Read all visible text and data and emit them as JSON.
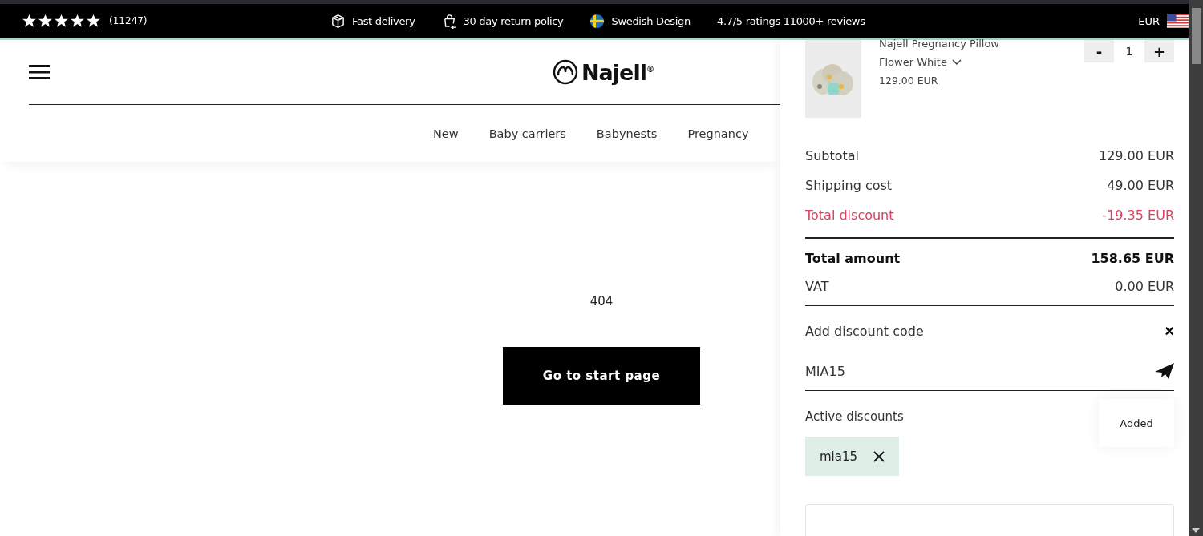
{
  "top_bar": {
    "rating": {
      "stars": 5,
      "count": "(11247)"
    },
    "usps": [
      {
        "kind": "box",
        "label": "Fast delivery"
      },
      {
        "kind": "return",
        "label": "30 day return policy"
      },
      {
        "kind": "flag",
        "label": "Swedish Design"
      },
      {
        "kind": "none",
        "label": "4.7/5 ratings 11000+ reviews"
      }
    ],
    "currency": "EUR"
  },
  "header": {
    "logo": "Najell",
    "logo_mark": "®"
  },
  "nav": [
    "New",
    "Baby carriers",
    "Babynests",
    "Pregnancy"
  ],
  "main": {
    "code": "404",
    "button": "Go to start page"
  },
  "cart": {
    "item": {
      "name": "Najell Pregnancy Pillow",
      "variant": "Flower White",
      "price": "129.00 EUR",
      "minus": "-",
      "quantity": "1",
      "plus": "+"
    },
    "summary": [
      {
        "kind": "normal",
        "label": "Subtotal",
        "value": "129.00 EUR"
      },
      {
        "kind": "normal",
        "label": "Shipping cost",
        "value": "49.00 EUR"
      },
      {
        "kind": "discount",
        "label": "Total discount",
        "value": "-19.35 EUR"
      },
      {
        "kind": "total",
        "label": "Total amount",
        "value": "158.65 EUR"
      },
      {
        "kind": "normal",
        "label": "VAT",
        "value": "0.00 EUR"
      }
    ],
    "discount_code": {
      "label": "Add discount code",
      "close": "×",
      "value": "MIA15"
    },
    "active_discounts": {
      "label": "Active discounts",
      "codes": [
        "mia15"
      ]
    },
    "toast": "Added"
  }
}
